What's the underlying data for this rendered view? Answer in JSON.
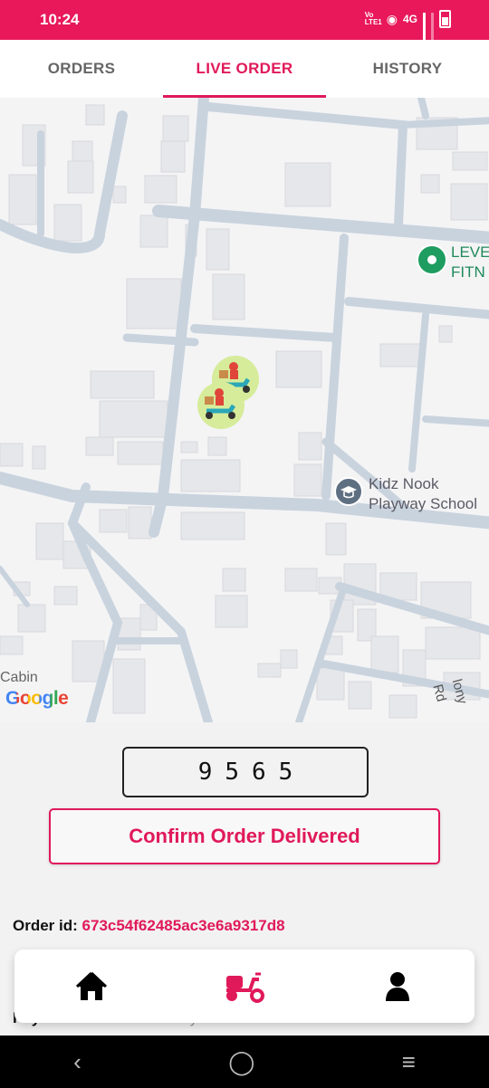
{
  "status_bar": {
    "time": "10:24",
    "network_type": "4G",
    "volte_label": "Vo LTE1"
  },
  "tabs": [
    {
      "label": "ORDERS",
      "active": false
    },
    {
      "label": "LIVE ORDER",
      "active": true
    },
    {
      "label": "HISTORY",
      "active": false
    }
  ],
  "map": {
    "pois": [
      {
        "name_line1": "LEVE",
        "name_line2": "FITN",
        "icon": "location-pin-icon"
      },
      {
        "name_line1": "Kidz Nook",
        "name_line2": "Playway School",
        "icon": "school-icon"
      }
    ],
    "labels": {
      "cabin": "Cabin",
      "road": "lony Rd"
    },
    "attribution": "Google"
  },
  "otp": {
    "code": "9565"
  },
  "confirm_button": {
    "label": "Confirm Order Delivered"
  },
  "order": {
    "id_label": "Order id:",
    "id_value": "673c54f62485ac3e6a9317d8",
    "payment_label": "Payment:",
    "payment_value": "cash on delivery"
  },
  "bottom_nav": [
    {
      "name": "home",
      "icon": "home-icon",
      "active": false
    },
    {
      "name": "delivery",
      "icon": "scooter-icon",
      "active": true
    },
    {
      "name": "profile",
      "icon": "user-icon",
      "active": false
    }
  ],
  "colors": {
    "accent": "#e0195a",
    "status_bar": "#e8185a",
    "map_bg": "#f4f4f5",
    "road": "#c9d3de"
  }
}
